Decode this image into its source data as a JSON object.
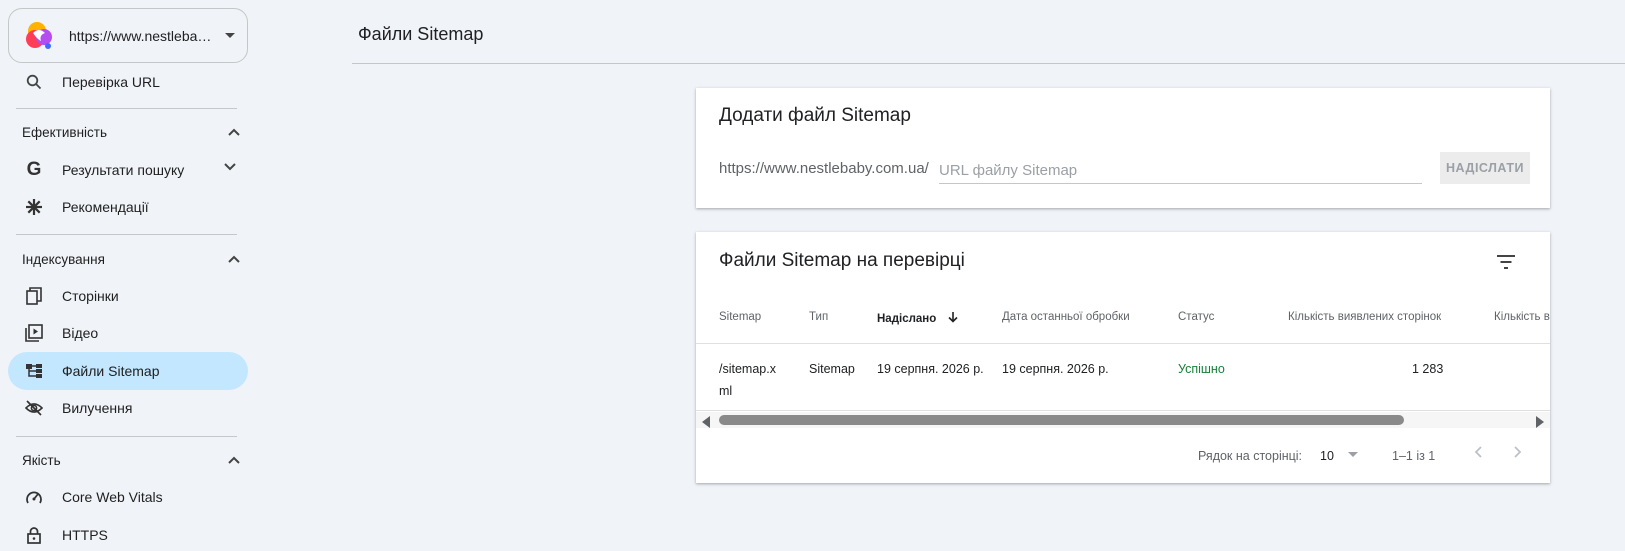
{
  "property": {
    "url": "https://www.nestlebaby.com.ua/"
  },
  "sidebar": {
    "url_inspection": "Перевірка URL",
    "sections": {
      "performance": "Ефективність",
      "indexing": "Індексування",
      "quality": "Якість"
    },
    "items": {
      "search_results": "Результати пошуку",
      "recommendations": "Рекомендації",
      "pages": "Сторінки",
      "video": "Відео",
      "sitemaps": "Файли Sitemap",
      "removals": "Вилучення",
      "core_web_vitals": "Core Web Vitals",
      "https": "HTTPS"
    }
  },
  "page_title": "Файли Sitemap",
  "add_card": {
    "title": "Додати файл Sitemap",
    "prefix": "https://www.nestlebaby.com.ua/",
    "placeholder": "URL файлу Sitemap",
    "submit_label": "НАДІСЛАТИ"
  },
  "table_card": {
    "title": "Файли Sitemap на перевірці",
    "columns": {
      "sitemap": "Sitemap",
      "type": "Тип",
      "submitted": "Надіслано",
      "last_read": "Дата останньої обробки",
      "status": "Статус",
      "discovered_pages": "Кількість виявлених сторінок",
      "discovered_videos": "Кількість в"
    },
    "rows": [
      {
        "sitemap_l1": "/sitemap.x",
        "sitemap_l2": "ml",
        "type": "Sitemap",
        "submitted": "19 серпня. 2026 р.",
        "last_read": "19 серпня. 2026 р.",
        "status": "Успішно",
        "discovered_pages": "1 283"
      }
    ],
    "pager": {
      "rows_label": "Рядок на сторінці:",
      "rows_value": "10",
      "range": "1–1 із 1"
    }
  },
  "colors": {
    "active_nav": "#c2e7ff",
    "success": "#188038",
    "background": "#f0f3f8"
  }
}
